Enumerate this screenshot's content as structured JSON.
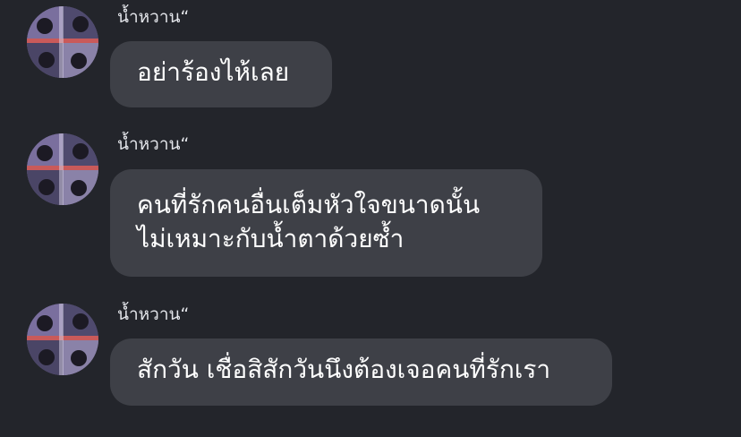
{
  "messages": [
    {
      "sender": "น้ำหวาน“",
      "lines": [
        "อย่าร้องไห้เลย"
      ]
    },
    {
      "sender": "น้ำหวาน“",
      "lines": [
        "คนที่รักคนอื่นเต็มหัวใจขนาดนั้น",
        "ไม่เหมาะกับน้ำตาด้วยซ้ำ"
      ]
    },
    {
      "sender": "น้ำหวาน“",
      "lines": [
        "สักวัน เชื่อสิสักวันนึงต้องเจอคนที่รักเรา"
      ]
    }
  ],
  "colors": {
    "background": "#23252b",
    "bubble": "#3e4047",
    "text": "#ffffff",
    "sender_text": "#e4e6eb"
  }
}
